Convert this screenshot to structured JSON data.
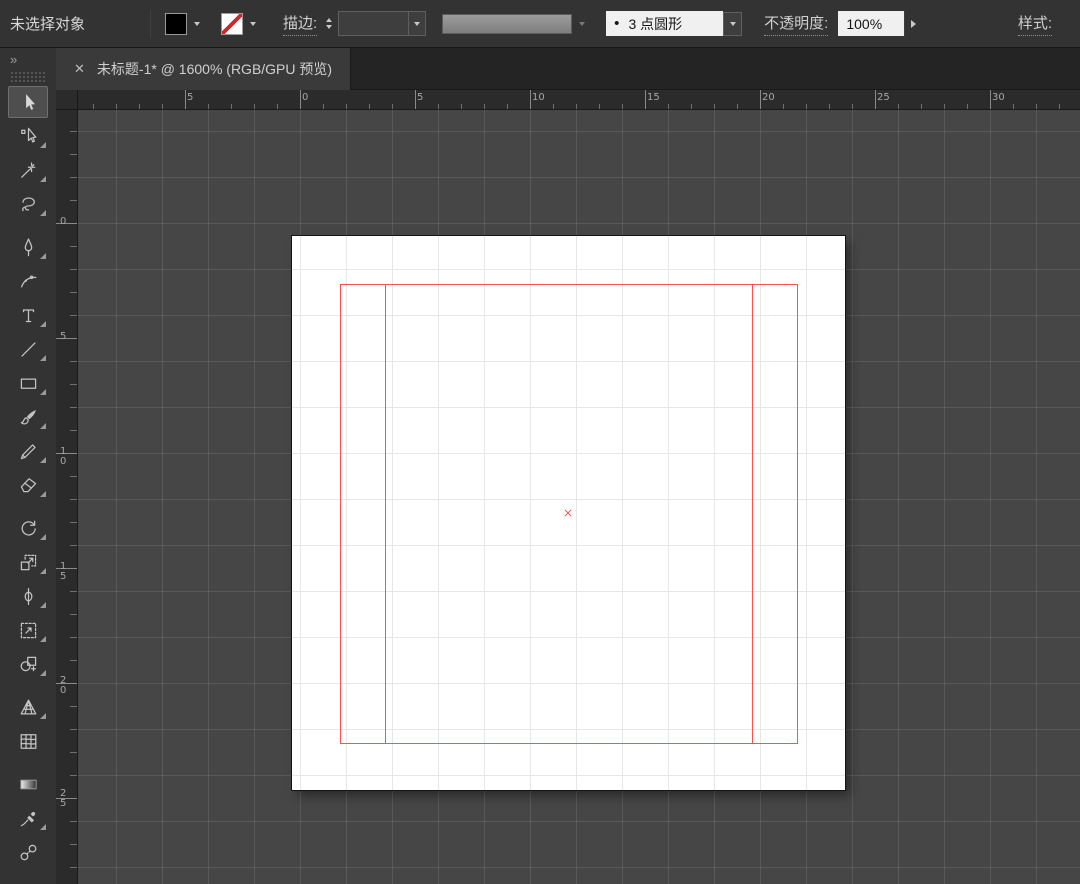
{
  "control_bar": {
    "status": "未选择对象",
    "fill_color": "#000000",
    "stroke_label": "描边:",
    "stroke_weight_value": "",
    "brush_bullet": "•",
    "brush_value": "3 点圆形",
    "opacity_label": "不透明度:",
    "opacity_value": "100%",
    "style_label": "样式:"
  },
  "tab": {
    "close_icon": "✕",
    "title": "未标题-1* @ 1600% (RGB/GPU 预览)"
  },
  "toolbar": {
    "expand_icon": "»",
    "tools": [
      {
        "name": "selection-tool",
        "active": true,
        "flyout": false
      },
      {
        "name": "direct-selection-tool",
        "flyout": true
      },
      {
        "name": "magic-wand-tool",
        "flyout": true
      },
      {
        "name": "lasso-tool",
        "flyout": true
      },
      {
        "name": "pen-tool",
        "flyout": true
      },
      {
        "name": "curvature-tool",
        "flyout": false
      },
      {
        "name": "type-tool",
        "flyout": true
      },
      {
        "name": "line-segment-tool",
        "flyout": true
      },
      {
        "name": "rectangle-tool",
        "flyout": true
      },
      {
        "name": "paintbrush-tool",
        "flyout": true
      },
      {
        "name": "shaper-tool",
        "flyout": true
      },
      {
        "name": "eraser-tool",
        "flyout": true
      },
      {
        "name": "rotate-tool",
        "flyout": true
      },
      {
        "name": "scale-tool",
        "flyout": true
      },
      {
        "name": "width-tool",
        "flyout": true
      },
      {
        "name": "free-transform-tool",
        "flyout": true
      },
      {
        "name": "shape-builder-tool",
        "flyout": true
      },
      {
        "name": "perspective-grid-tool",
        "flyout": true
      },
      {
        "name": "mesh-tool",
        "flyout": false
      },
      {
        "name": "gradient-tool",
        "flyout": false
      },
      {
        "name": "eyedropper-tool",
        "flyout": true
      },
      {
        "name": "blend-tool",
        "flyout": false
      }
    ]
  },
  "rulers": {
    "top": [
      "5",
      "0",
      "5",
      "10",
      "15",
      "20",
      "25",
      "30"
    ],
    "left": [
      "0",
      "5",
      "10",
      "15",
      "20",
      "25"
    ]
  },
  "canvas": {
    "guide_color": "#ff4f4f",
    "artboard_color": "#ffffff"
  }
}
